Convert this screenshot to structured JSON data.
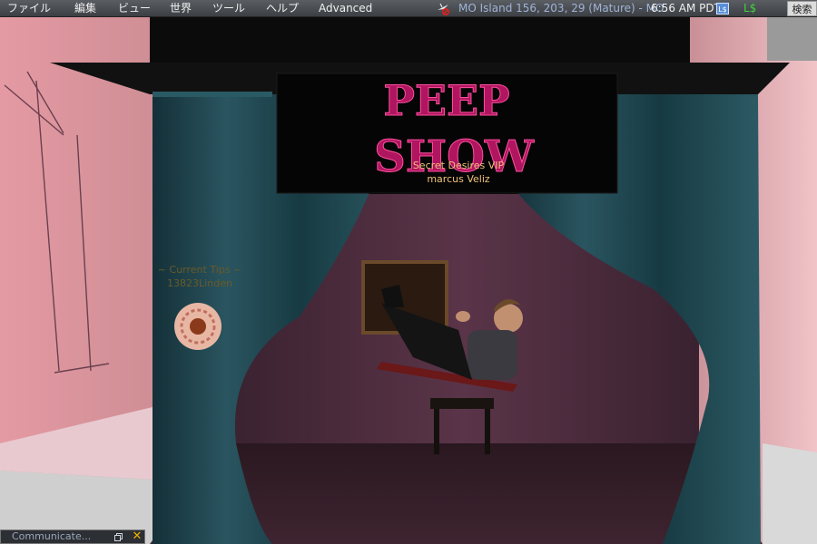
{
  "menu": {
    "items": [
      {
        "label": "ファイル"
      },
      {
        "label": "編集"
      },
      {
        "label": "ビュー"
      },
      {
        "label": "世界"
      },
      {
        "label": "ツール"
      },
      {
        "label": "ヘルプ"
      },
      {
        "label": "Advanced"
      }
    ]
  },
  "status": {
    "location": "MO Island 156, 203, 29 (Mature) - MO",
    "time": "6:56 AM PDT",
    "buy_currency_label": "L$",
    "balance": "L$",
    "search_label": "検索"
  },
  "scene": {
    "sign_line1": "PEEP",
    "sign_line2": "SHOW",
    "tip_jar_line1": "~ Current Tips ~",
    "tip_jar_line2": "13823Linden",
    "avatar_group": "Secret Desires VIP",
    "avatar_name": "marcus Veliz"
  },
  "communicate": {
    "label": "Communicate..."
  },
  "colors": {
    "menu_bg": "#4a4d51",
    "location_text": "#9fb3d8",
    "balance_text": "#3fd03f",
    "nametag_text": "#f0c27a",
    "sign_text": "#b0155f",
    "curtain": "#1f4a52",
    "wall_left": "#d08a92"
  }
}
